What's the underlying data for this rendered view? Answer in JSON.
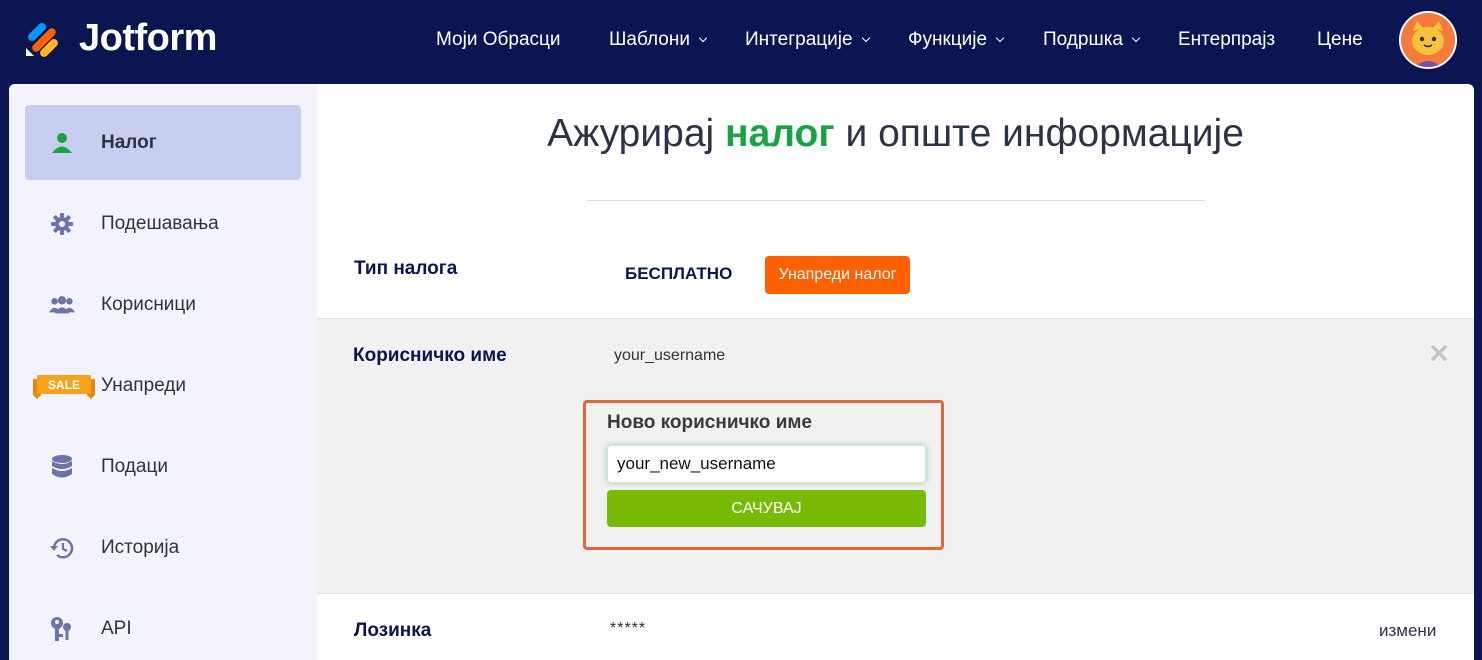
{
  "brand": {
    "name": "Jotform"
  },
  "nav": {
    "items": [
      {
        "label": "Моји Обрасци",
        "dropdown": false
      },
      {
        "label": "Шаблони",
        "dropdown": true
      },
      {
        "label": "Интеграције",
        "dropdown": true
      },
      {
        "label": "Функције",
        "dropdown": true
      },
      {
        "label": "Подршка",
        "dropdown": true
      },
      {
        "label": "Ентерпрајз",
        "dropdown": false
      },
      {
        "label": "Цене",
        "dropdown": false
      }
    ]
  },
  "sidebar": {
    "items": [
      {
        "label": "Налог",
        "icon": "user-icon",
        "active": true
      },
      {
        "label": "Подешавања",
        "icon": "gear-icon",
        "active": false
      },
      {
        "label": "Корисници",
        "icon": "users-icon",
        "active": false
      },
      {
        "label": "Унапреди",
        "icon": "sale-tag-icon",
        "icon_text": "SALE",
        "active": false
      },
      {
        "label": "Подаци",
        "icon": "database-icon",
        "active": false
      },
      {
        "label": "Историја",
        "icon": "history-icon",
        "active": false
      },
      {
        "label": "API",
        "icon": "keys-icon",
        "active": false
      }
    ]
  },
  "main": {
    "title_before": "Ажурирај ",
    "title_accent": "налог",
    "title_after": " и опште информације",
    "account_type": {
      "label": "Тип налога",
      "value": "БЕСПЛАТНО",
      "upgrade_button": "Унапреди налог"
    },
    "username": {
      "label": "Корисничко име",
      "current_value": "your_username",
      "form": {
        "label": "Ново корисничко име",
        "input_value": "your_new_username",
        "save_button": "САЧУВАЈ"
      }
    },
    "password": {
      "label": "Лозинка",
      "value": "*****",
      "change_link": "измени"
    }
  },
  "colors": {
    "navy": "#0a1551",
    "accent_green": "#18a346",
    "upgrade_orange": "#ff6100",
    "save_green": "#78bb07",
    "highlight_border": "#e0663a",
    "active_sidebar": "#c8cef0",
    "sidebar_bg": "#f3f3fe"
  }
}
